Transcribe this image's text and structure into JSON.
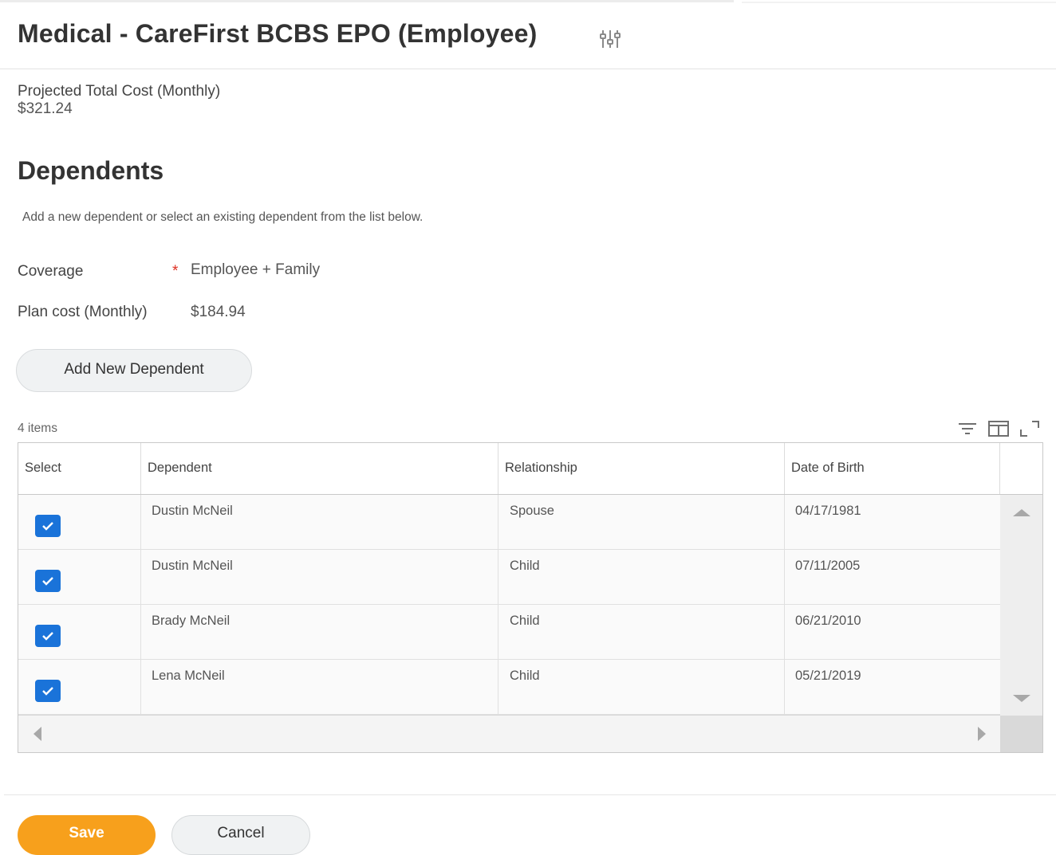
{
  "header": {
    "title": "Medical - CareFirst BCBS EPO (Employee)",
    "icon": "related-actions-sliders-icon"
  },
  "projected_cost": {
    "label": "Projected Total Cost (Monthly)",
    "value": "$321.24"
  },
  "dependents": {
    "section_title": "Dependents",
    "instructions": "Add a new dependent or select an existing dependent from the list below.",
    "coverage_label": "Coverage",
    "required_mark": "*",
    "coverage_value": "Employee + Family",
    "plan_cost_label": "Plan cost (Monthly)",
    "plan_cost_value": "$184.94",
    "add_button_label": "Add New Dependent"
  },
  "grid": {
    "items_count": "4 items",
    "tools": [
      "filter-icon",
      "columns-icon",
      "expand-icon"
    ],
    "columns": [
      "Select",
      "Dependent",
      "Relationship",
      "Date of Birth"
    ],
    "rows": [
      {
        "selected": true,
        "dependent": "Dustin McNeil",
        "relationship": "Spouse",
        "dob": "04/17/1981"
      },
      {
        "selected": true,
        "dependent": "Dustin McNeil",
        "relationship": "Child",
        "dob": "07/11/2005"
      },
      {
        "selected": true,
        "dependent": "Brady McNeil",
        "relationship": "Child",
        "dob": "06/21/2010"
      },
      {
        "selected": true,
        "dependent": "Lena McNeil",
        "relationship": "Child",
        "dob": "05/21/2019"
      }
    ]
  },
  "footer": {
    "save_label": "Save",
    "cancel_label": "Cancel"
  },
  "colors": {
    "primary_button": "#f7a01c",
    "checkbox": "#1a73d9",
    "required": "#de2e21"
  }
}
